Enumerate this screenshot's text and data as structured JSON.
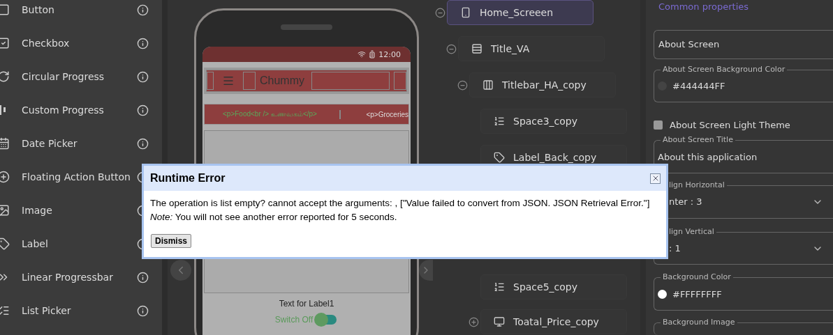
{
  "palette": {
    "items": [
      {
        "label": "Button"
      },
      {
        "label": "Checkbox"
      },
      {
        "label": "Circular Progress"
      },
      {
        "label": "Custom Progress"
      },
      {
        "label": "Date Picker"
      },
      {
        "label": "Floating Action Button"
      },
      {
        "label": "Image"
      },
      {
        "label": "Label"
      },
      {
        "label": "Linear Progressbar"
      },
      {
        "label": "List Picker"
      }
    ]
  },
  "phone": {
    "status_time": "12:00",
    "app_title": "Chummy",
    "tabs": [
      {
        "label": "<p>Food<br /> உணவகம்</p>"
      },
      {
        "label": "<p>Groceries"
      }
    ],
    "label_text": "Text for Label1",
    "switch": {
      "label": "Switch Off",
      "on": false
    }
  },
  "tree": [
    {
      "label": "Home_Screeen",
      "kind": "screen",
      "selected": true,
      "expanded": true,
      "children": [
        {
          "label": "Title_VA",
          "kind": "vertical",
          "selected": false,
          "expanded": true,
          "children": [
            {
              "label": "Titlebar_HA_copy",
              "kind": "horizontal",
              "selected": false,
              "expanded": true,
              "children": [
                {
                  "label": "Space3_copy",
                  "kind": "space",
                  "selected": false
                },
                {
                  "label": "Label_Back_copy",
                  "kind": "label",
                  "selected": false
                }
              ]
            }
          ]
        }
      ]
    }
  ],
  "tree_lower": [
    {
      "label": "Space5_copy",
      "kind": "space",
      "selected": false
    },
    {
      "label": "Toatal_Price_copy",
      "kind": "button",
      "selected": false,
      "expanded": false
    }
  ],
  "properties": {
    "heading": "Common properties",
    "fields": [
      {
        "kind": "area",
        "value": "About Screen"
      },
      {
        "kind": "color",
        "label": "About Screen Background Color",
        "value": "#444444FF",
        "color": "#444444"
      },
      {
        "kind": "checkbox",
        "label": "About Screen Light Theme",
        "checked": false
      },
      {
        "kind": "text",
        "label": "About Screen Title",
        "value": "About this application"
      },
      {
        "kind": "select",
        "label": "lign Horizontal",
        "value": "nter : 3"
      },
      {
        "kind": "select",
        "label": "lign Vertical",
        "value": ": 1"
      },
      {
        "kind": "color",
        "label": "Background Color",
        "value": "#FFFFFFFF",
        "color": "#ffffff"
      },
      {
        "kind": "image",
        "label": "Background Image"
      }
    ]
  },
  "dialog": {
    "title": "Runtime Error",
    "message": "The operation is list empty? cannot accept the arguments: , [\"Value failed to convert from JSON. JSON Retrieval Error.\"]",
    "note": "*Note:* You will not see another error reported for 5 seconds.",
    "button": "Dismiss"
  }
}
